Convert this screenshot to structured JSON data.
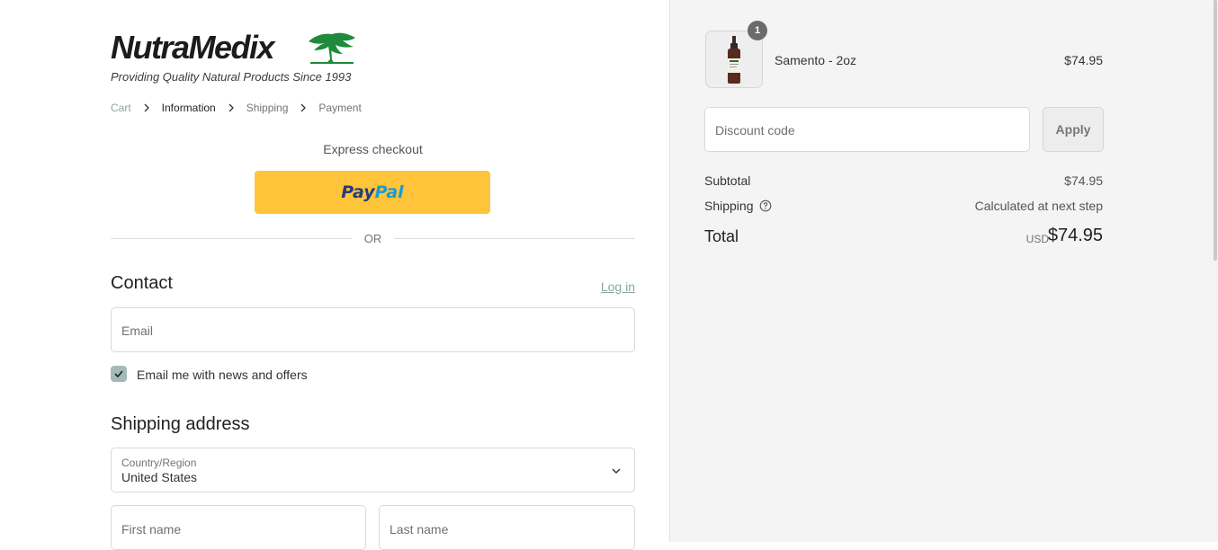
{
  "brand": {
    "name": "NutraMedix",
    "tagline": "Providing Quality Natural Products Since 1993"
  },
  "breadcrumb": [
    {
      "label": "Cart",
      "state": "link"
    },
    {
      "label": "Information",
      "state": "active"
    },
    {
      "label": "Shipping",
      "state": "upcoming"
    },
    {
      "label": "Payment",
      "state": "upcoming"
    }
  ],
  "express": {
    "title": "Express checkout",
    "paypal_pay": "Pay",
    "paypal_pal": "Pal"
  },
  "divider_text": "OR",
  "contact": {
    "title": "Contact",
    "login_link": "Log in",
    "email_placeholder": "Email",
    "news_opt_in_label": "Email me with news and offers",
    "news_opt_in_checked": true
  },
  "shipping_address": {
    "title": "Shipping address",
    "country_label": "Country/Region",
    "country_value": "United States",
    "first_name_placeholder": "First name",
    "last_name_placeholder": "Last name"
  },
  "order": {
    "item": {
      "name": "Samento - 2oz",
      "price": "$74.95",
      "quantity": "1"
    },
    "discount_placeholder": "Discount code",
    "apply_label": "Apply",
    "subtotal_label": "Subtotal",
    "subtotal_value": "$74.95",
    "shipping_label": "Shipping",
    "shipping_value": "Calculated at next step",
    "total_label": "Total",
    "currency": "USD",
    "total_value": "$74.95"
  },
  "colors": {
    "paypal_yellow": "#ffc439",
    "accent_link": "#8aa7a1",
    "checkbox": "#a3bab5",
    "sidebar_bg": "#f4f4f4",
    "logo_green": "#1f8a3b"
  }
}
